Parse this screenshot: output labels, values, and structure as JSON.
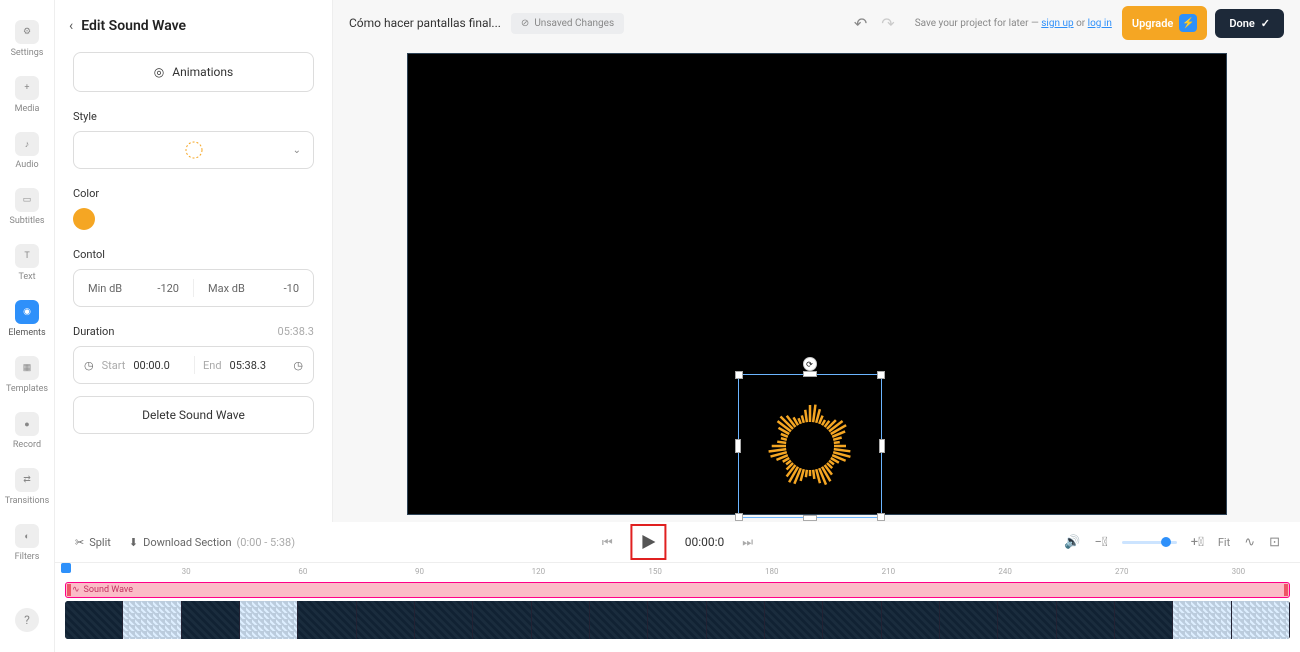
{
  "nav": {
    "items": [
      {
        "label": "Settings",
        "icon": "gear"
      },
      {
        "label": "Media",
        "icon": "plus"
      },
      {
        "label": "Audio",
        "icon": "music"
      },
      {
        "label": "Subtitles",
        "icon": "cc"
      },
      {
        "label": "Text",
        "icon": "text"
      },
      {
        "label": "Elements",
        "icon": "elements",
        "active": true
      },
      {
        "label": "Templates",
        "icon": "templates"
      },
      {
        "label": "Record",
        "icon": "camera"
      },
      {
        "label": "Transitions",
        "icon": "transitions"
      },
      {
        "label": "Filters",
        "icon": "filters"
      }
    ],
    "help": "?"
  },
  "panel": {
    "title": "Edit Sound Wave",
    "animations_label": "Animations",
    "style_label": "Style",
    "color_label": "Color",
    "color_value": "#f5a623",
    "control_label": "Contol",
    "min_db_label": "Min dB",
    "min_db_value": "-120",
    "max_db_label": "Max dB",
    "max_db_value": "-10",
    "duration_label": "Duration",
    "duration_value": "05:38.3",
    "start_label": "Start",
    "start_value": "00:00.0",
    "end_label": "End",
    "end_value": "05:38.3",
    "delete_label": "Delete Sound Wave"
  },
  "header": {
    "project_title": "Cómo hacer pantallas final...",
    "unsaved_label": "Unsaved Changes",
    "save_prompt_pre": "Save your project for later — ",
    "signup": "sign up",
    "or": " or ",
    "login": "log in",
    "upgrade": "Upgrade",
    "done": "Done"
  },
  "playback": {
    "split": "Split",
    "download_section": "Download Section",
    "download_range": "(0:00 - 5:38)",
    "time": "00:00:0",
    "fit": "Fit"
  },
  "timeline": {
    "ticks": [
      "30",
      "60",
      "90",
      "120",
      "150",
      "180",
      "210",
      "240",
      "270",
      "300"
    ],
    "sound_wave_label": "Sound Wave"
  }
}
